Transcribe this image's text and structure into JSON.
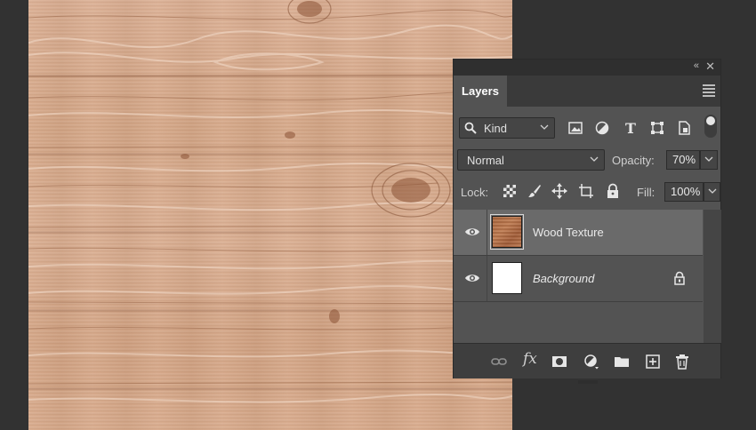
{
  "panel": {
    "collapse_glyph": "«",
    "close_glyph": "✕",
    "tab_label": "Layers"
  },
  "filter": {
    "kind_label": "Kind",
    "icons": [
      "search-icon",
      "image-filter-icon",
      "adjustment-filter-icon",
      "type-filter-icon",
      "shape-filter-icon",
      "smart-object-filter-icon"
    ]
  },
  "blend": {
    "mode": "Normal",
    "opacity_label": "Opacity:",
    "opacity_value": "70%"
  },
  "lock": {
    "label": "Lock:",
    "fill_label": "Fill:",
    "fill_value": "100%",
    "icons": [
      "lock-transparent-pixels-icon",
      "lock-image-pixels-icon",
      "lock-position-icon",
      "lock-artboard-icon",
      "lock-all-icon"
    ]
  },
  "layers": [
    {
      "name": "Wood Texture",
      "visible": true,
      "selected": true,
      "locked": false
    },
    {
      "name": "Background",
      "visible": true,
      "selected": false,
      "locked": true
    }
  ],
  "bottom": {
    "fx_label": "fx",
    "icons": [
      "link-layers-icon",
      "layer-style-icon",
      "add-mask-icon",
      "new-adjustment-layer-icon",
      "new-group-icon",
      "new-layer-icon",
      "delete-layer-icon"
    ]
  },
  "colors": {
    "workspace": "#323232",
    "panel": "#535353",
    "selected_layer": "#6a6a6a",
    "wood": "#d9ac8c"
  }
}
